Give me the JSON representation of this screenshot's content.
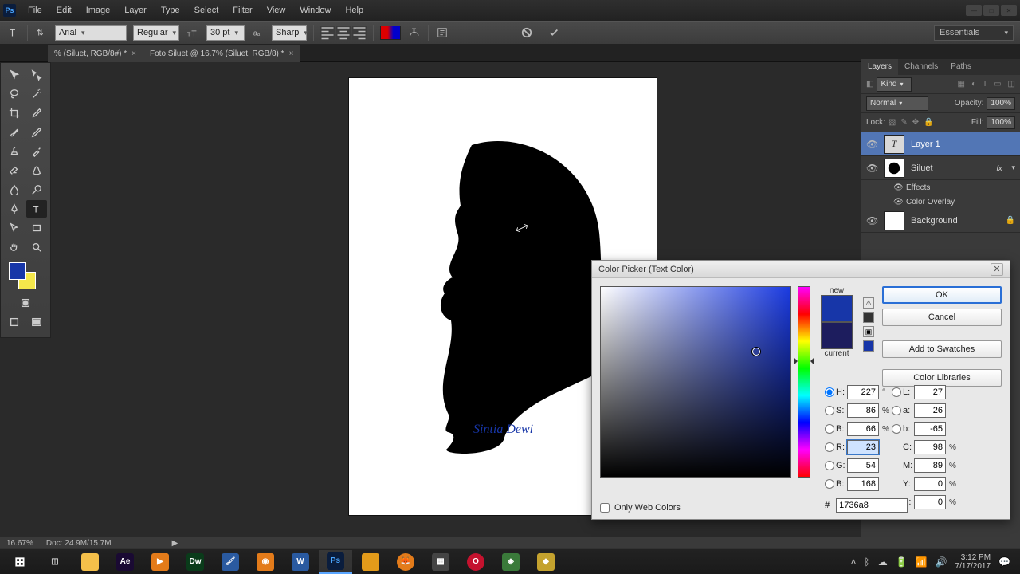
{
  "app": {
    "logo": "Ps"
  },
  "menu": [
    "File",
    "Edit",
    "Image",
    "Layer",
    "Type",
    "Select",
    "Filter",
    "View",
    "Window",
    "Help"
  ],
  "options": {
    "font": "Arial",
    "weight": "Regular",
    "size": "30 pt",
    "aa": "Sharp",
    "workspace": "Essentials"
  },
  "tabs": [
    {
      "label": "% (Siluet, RGB/8#) *"
    },
    {
      "label": "Foto Siluet @ 16.7% (Siluet, RGB/8) *"
    }
  ],
  "canvas": {
    "text": "Sintia Dewi"
  },
  "layers_panel": {
    "tabs": [
      "Layers",
      "Channels",
      "Paths"
    ],
    "kind_label": "Kind",
    "blend_mode": "Normal",
    "opacity_label": "Opacity:",
    "opacity_value": "100%",
    "lock_label": "Lock:",
    "fill_label": "Fill:",
    "fill_value": "100%",
    "layers": [
      {
        "name": "Layer 1",
        "type": "text"
      },
      {
        "name": "Siluet",
        "type": "image",
        "fx": "fx"
      },
      {
        "name": "Background",
        "type": "bg"
      }
    ],
    "effects_label": "Effects",
    "color_overlay_label": "Color Overlay"
  },
  "color_picker": {
    "title": "Color Picker (Text Color)",
    "new_label": "new",
    "current_label": "current",
    "buttons": {
      "ok": "OK",
      "cancel": "Cancel",
      "swatches": "Add to Swatches",
      "libraries": "Color Libraries"
    },
    "H": "227",
    "S": "86",
    "B": "66",
    "R": "23",
    "G": "54",
    "Bb": "168",
    "L": "27",
    "a": "26",
    "b": "-65",
    "C": "98",
    "M": "89",
    "Y": "0",
    "K": "0",
    "hex": "1736a8",
    "only_web": "Only Web Colors",
    "degree": "°",
    "percent": "%"
  },
  "status": {
    "zoom": "16.67%",
    "doc": "Doc: 24.9M/15.7M"
  },
  "tray": {
    "time": "3:12 PM",
    "date": "7/17/2017"
  }
}
